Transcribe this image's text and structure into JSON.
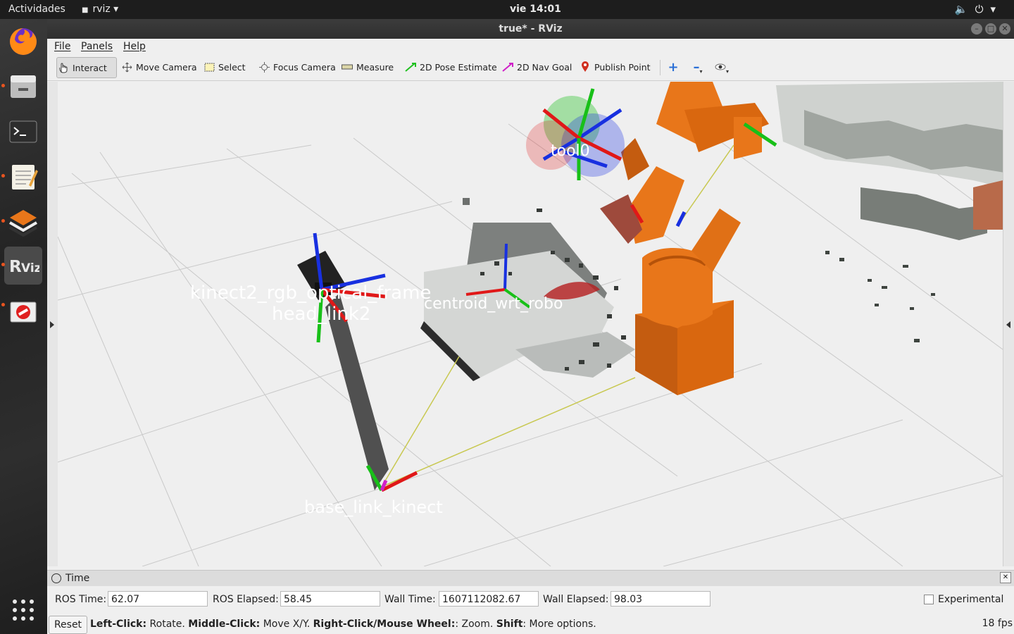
{
  "topbar": {
    "activities": "Actividades",
    "app_name": "rviz",
    "clock": "vie 14:01",
    "tray_icons": [
      "volume-icon",
      "power-icon",
      "chevron-down-icon"
    ]
  },
  "dock": {
    "items": [
      "firefox-icon",
      "files-icon",
      "terminal-icon",
      "text-editor-icon",
      "layers-icon",
      "rviz-icon",
      "block-icon"
    ],
    "show_apps": "apps-grid-icon"
  },
  "window": {
    "title": "true* - RViz"
  },
  "menubar": {
    "file": "File",
    "panels": "Panels",
    "help": "Help"
  },
  "toolbar": {
    "interact": "Interact",
    "move_camera": "Move Camera",
    "select": "Select",
    "focus_camera": "Focus Camera",
    "measure": "Measure",
    "pose_estimate": "2D Pose Estimate",
    "nav_goal": "2D Nav Goal",
    "publish_point": "Publish Point"
  },
  "viewport": {
    "frame_labels": {
      "kinect_overlap": "kinect2_rgb_optical_frame",
      "head_link": "head_link2",
      "centroid": "centroid_wrt_robo",
      "base_link": "base_link_kinect",
      "robot_tool": "tool0"
    },
    "colors": {
      "background": "#efefef",
      "robot": "#e8761a",
      "axis_x": "#e01818",
      "axis_y": "#18c018",
      "axis_z": "#1830e0",
      "tf_line": "#c8c850"
    }
  },
  "time_panel": {
    "title": "Time",
    "ros_time_label": "ROS Time:",
    "ros_time": "62.07",
    "ros_elapsed_label": "ROS Elapsed:",
    "ros_elapsed": "58.45",
    "wall_time_label": "Wall Time:",
    "wall_time": "1607112082.67",
    "wall_elapsed_label": "Wall Elapsed:",
    "wall_elapsed": "98.03",
    "experimental": "Experimental"
  },
  "statusbar": {
    "reset": "Reset",
    "hint_left_click": "Left-Click:",
    "hint_rotate": " Rotate. ",
    "hint_middle_click": "Middle-Click:",
    "hint_move": " Move X/Y. ",
    "hint_right_click": "Right-Click/Mouse Wheel:",
    "hint_zoom": ": Zoom. ",
    "hint_shift": "Shift",
    "hint_more": ": More options.",
    "fps": "18 fps"
  }
}
